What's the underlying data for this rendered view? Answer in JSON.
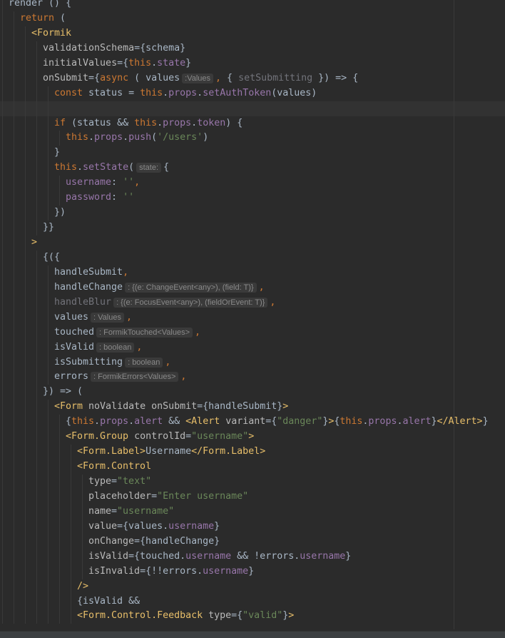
{
  "editor": {
    "current_line": 8,
    "lines": [
      {
        "indent": 0,
        "tokens": [
          {
            "c": "f",
            "t": "render"
          },
          {
            "c": "t",
            "t": " () {"
          }
        ]
      },
      {
        "indent": 2,
        "tokens": [
          {
            "c": "k",
            "t": "return"
          },
          {
            "c": "t",
            "t": " ("
          }
        ]
      },
      {
        "indent": 4,
        "tokens": [
          {
            "c": "g",
            "t": "<Formik"
          }
        ]
      },
      {
        "indent": 6,
        "tokens": [
          {
            "c": "a",
            "t": "validationSchema"
          },
          {
            "c": "t",
            "t": "={schema}"
          }
        ]
      },
      {
        "indent": 6,
        "tokens": [
          {
            "c": "a",
            "t": "initialValues"
          },
          {
            "c": "t",
            "t": "={"
          },
          {
            "c": "k",
            "t": "this"
          },
          {
            "c": "t",
            "t": "."
          },
          {
            "c": "p",
            "t": "state"
          },
          {
            "c": "t",
            "t": "}"
          }
        ]
      },
      {
        "indent": 6,
        "tokens": [
          {
            "c": "a",
            "t": "onSubmit"
          },
          {
            "c": "t",
            "t": "={"
          },
          {
            "c": "k",
            "t": "async"
          },
          {
            "c": "t",
            "t": " ( values"
          },
          {
            "c": "h",
            "t": ":Values"
          },
          {
            "c": "k",
            "t": ","
          },
          {
            "c": "t",
            "t": " { "
          },
          {
            "c": "u",
            "t": "setSubmitting"
          },
          {
            "c": "t",
            "t": " }) => {"
          }
        ]
      },
      {
        "indent": 8,
        "tokens": [
          {
            "c": "k",
            "t": "const"
          },
          {
            "c": "t",
            "t": " status = "
          },
          {
            "c": "k",
            "t": "this"
          },
          {
            "c": "t",
            "t": "."
          },
          {
            "c": "p",
            "t": "props"
          },
          {
            "c": "t",
            "t": "."
          },
          {
            "c": "p",
            "t": "setAuthToken"
          },
          {
            "c": "t",
            "t": "(values)"
          }
        ]
      },
      {
        "indent": 8,
        "tokens": []
      },
      {
        "indent": 8,
        "tokens": [
          {
            "c": "k",
            "t": "if"
          },
          {
            "c": "t",
            "t": " (status && "
          },
          {
            "c": "k",
            "t": "this"
          },
          {
            "c": "t",
            "t": "."
          },
          {
            "c": "p",
            "t": "props"
          },
          {
            "c": "t",
            "t": "."
          },
          {
            "c": "p",
            "t": "token"
          },
          {
            "c": "t",
            "t": ") {"
          }
        ]
      },
      {
        "indent": 10,
        "tokens": [
          {
            "c": "k",
            "t": "this"
          },
          {
            "c": "t",
            "t": "."
          },
          {
            "c": "p",
            "t": "props"
          },
          {
            "c": "t",
            "t": "."
          },
          {
            "c": "p",
            "t": "push"
          },
          {
            "c": "t",
            "t": "("
          },
          {
            "c": "s",
            "t": "'/users'"
          },
          {
            "c": "t",
            "t": ")"
          }
        ]
      },
      {
        "indent": 8,
        "tokens": [
          {
            "c": "t",
            "t": "}"
          }
        ]
      },
      {
        "indent": 8,
        "tokens": [
          {
            "c": "k",
            "t": "this"
          },
          {
            "c": "t",
            "t": "."
          },
          {
            "c": "p",
            "t": "setState"
          },
          {
            "c": "t",
            "t": "("
          },
          {
            "c": "h",
            "t": "state:"
          },
          {
            "c": "t",
            "t": "{"
          }
        ]
      },
      {
        "indent": 10,
        "tokens": [
          {
            "c": "p",
            "t": "username"
          },
          {
            "c": "t",
            "t": ": "
          },
          {
            "c": "s",
            "t": "''"
          },
          {
            "c": "k",
            "t": ","
          }
        ]
      },
      {
        "indent": 10,
        "tokens": [
          {
            "c": "p",
            "t": "password"
          },
          {
            "c": "t",
            "t": ": "
          },
          {
            "c": "s",
            "t": "''"
          }
        ]
      },
      {
        "indent": 8,
        "tokens": [
          {
            "c": "t",
            "t": "})"
          }
        ]
      },
      {
        "indent": 6,
        "tokens": [
          {
            "c": "t",
            "t": "}}"
          }
        ]
      },
      {
        "indent": 4,
        "tokens": [
          {
            "c": "g",
            "t": ">"
          }
        ]
      },
      {
        "indent": 6,
        "tokens": [
          {
            "c": "t",
            "t": "{({"
          }
        ]
      },
      {
        "indent": 8,
        "tokens": [
          {
            "c": "t",
            "t": "handleSubmit"
          },
          {
            "c": "k",
            "t": ","
          }
        ]
      },
      {
        "indent": 8,
        "tokens": [
          {
            "c": "t",
            "t": "handleChange"
          },
          {
            "c": "h",
            "t": ": {(e: ChangeEvent<any>), (field: T)}"
          },
          {
            "c": "k",
            "t": ","
          }
        ]
      },
      {
        "indent": 8,
        "tokens": [
          {
            "c": "u",
            "t": "handleBlur"
          },
          {
            "c": "h",
            "t": ": {(e: FocusEvent<any>), (fieldOrEvent: T)}"
          },
          {
            "c": "k",
            "t": ","
          }
        ]
      },
      {
        "indent": 8,
        "tokens": [
          {
            "c": "t",
            "t": "values"
          },
          {
            "c": "h",
            "t": ": Values"
          },
          {
            "c": "k",
            "t": ","
          }
        ]
      },
      {
        "indent": 8,
        "tokens": [
          {
            "c": "t",
            "t": "touched"
          },
          {
            "c": "h",
            "t": ": FormikTouched<Values>"
          },
          {
            "c": "k",
            "t": ","
          }
        ]
      },
      {
        "indent": 8,
        "tokens": [
          {
            "c": "t",
            "t": "isValid"
          },
          {
            "c": "h",
            "t": ": boolean"
          },
          {
            "c": "k",
            "t": ","
          }
        ]
      },
      {
        "indent": 8,
        "tokens": [
          {
            "c": "t",
            "t": "isSubmitting"
          },
          {
            "c": "h",
            "t": ": boolean"
          },
          {
            "c": "k",
            "t": ","
          }
        ]
      },
      {
        "indent": 8,
        "tokens": [
          {
            "c": "t",
            "t": "errors"
          },
          {
            "c": "h",
            "t": ": FormikErrors<Values>"
          },
          {
            "c": "k",
            "t": ","
          }
        ]
      },
      {
        "indent": 6,
        "tokens": [
          {
            "c": "t",
            "t": "}) => ("
          }
        ]
      },
      {
        "indent": 8,
        "tokens": [
          {
            "c": "g",
            "t": "<Form"
          },
          {
            "c": "a",
            "t": " noValidate onSubmit"
          },
          {
            "c": "t",
            "t": "={handleSubmit}"
          },
          {
            "c": "g",
            "t": ">"
          }
        ]
      },
      {
        "indent": 10,
        "tokens": [
          {
            "c": "t",
            "t": "{"
          },
          {
            "c": "k",
            "t": "this"
          },
          {
            "c": "t",
            "t": "."
          },
          {
            "c": "p",
            "t": "props"
          },
          {
            "c": "t",
            "t": "."
          },
          {
            "c": "p",
            "t": "alert"
          },
          {
            "c": "t",
            "t": " && "
          },
          {
            "c": "g",
            "t": "<Alert"
          },
          {
            "c": "a",
            "t": " variant"
          },
          {
            "c": "t",
            "t": "={"
          },
          {
            "c": "s",
            "t": "\"danger\""
          },
          {
            "c": "t",
            "t": "}"
          },
          {
            "c": "g",
            "t": ">"
          },
          {
            "c": "t",
            "t": "{"
          },
          {
            "c": "k",
            "t": "this"
          },
          {
            "c": "t",
            "t": "."
          },
          {
            "c": "p",
            "t": "props"
          },
          {
            "c": "t",
            "t": "."
          },
          {
            "c": "p",
            "t": "alert"
          },
          {
            "c": "t",
            "t": "}"
          },
          {
            "c": "g",
            "t": "</Alert>"
          },
          {
            "c": "t",
            "t": "}"
          }
        ]
      },
      {
        "indent": 10,
        "tokens": [
          {
            "c": "g",
            "t": "<Form.Group"
          },
          {
            "c": "a",
            "t": " controlId"
          },
          {
            "c": "t",
            "t": "="
          },
          {
            "c": "s",
            "t": "\"username\""
          },
          {
            "c": "g",
            "t": ">"
          }
        ]
      },
      {
        "indent": 12,
        "tokens": [
          {
            "c": "g",
            "t": "<Form.Label>"
          },
          {
            "c": "t",
            "t": "Username"
          },
          {
            "c": "g",
            "t": "</Form.Label>"
          }
        ]
      },
      {
        "indent": 12,
        "tokens": [
          {
            "c": "g",
            "t": "<Form.Control"
          }
        ]
      },
      {
        "indent": 14,
        "tokens": [
          {
            "c": "a",
            "t": "type"
          },
          {
            "c": "t",
            "t": "="
          },
          {
            "c": "s",
            "t": "\"text\""
          }
        ]
      },
      {
        "indent": 14,
        "tokens": [
          {
            "c": "a",
            "t": "placeholder"
          },
          {
            "c": "t",
            "t": "="
          },
          {
            "c": "s",
            "t": "\"Enter username\""
          }
        ]
      },
      {
        "indent": 14,
        "tokens": [
          {
            "c": "a",
            "t": "name"
          },
          {
            "c": "t",
            "t": "="
          },
          {
            "c": "s",
            "t": "\"username\""
          }
        ]
      },
      {
        "indent": 14,
        "tokens": [
          {
            "c": "a",
            "t": "value"
          },
          {
            "c": "t",
            "t": "={values."
          },
          {
            "c": "p",
            "t": "username"
          },
          {
            "c": "t",
            "t": "}"
          }
        ]
      },
      {
        "indent": 14,
        "tokens": [
          {
            "c": "a",
            "t": "onChange"
          },
          {
            "c": "t",
            "t": "={handleChange}"
          }
        ]
      },
      {
        "indent": 14,
        "tokens": [
          {
            "c": "a",
            "t": "isValid"
          },
          {
            "c": "t",
            "t": "={touched."
          },
          {
            "c": "p",
            "t": "username"
          },
          {
            "c": "t",
            "t": " && !errors."
          },
          {
            "c": "p",
            "t": "username"
          },
          {
            "c": "t",
            "t": "}"
          }
        ]
      },
      {
        "indent": 14,
        "tokens": [
          {
            "c": "a",
            "t": "isInvalid"
          },
          {
            "c": "t",
            "t": "={!!errors."
          },
          {
            "c": "p",
            "t": "username"
          },
          {
            "c": "t",
            "t": "}"
          }
        ]
      },
      {
        "indent": 12,
        "tokens": [
          {
            "c": "g",
            "t": "/>"
          }
        ]
      },
      {
        "indent": 12,
        "tokens": [
          {
            "c": "t",
            "t": "{isValid &&"
          }
        ]
      },
      {
        "indent": 12,
        "tokens": [
          {
            "c": "g",
            "t": "<Form.Control.Feedback"
          },
          {
            "c": "a",
            "t": " type"
          },
          {
            "c": "t",
            "t": "={"
          },
          {
            "c": "s",
            "t": "\"valid\""
          },
          {
            "c": "t",
            "t": "}"
          },
          {
            "c": "g",
            "t": ">"
          }
        ]
      }
    ]
  }
}
